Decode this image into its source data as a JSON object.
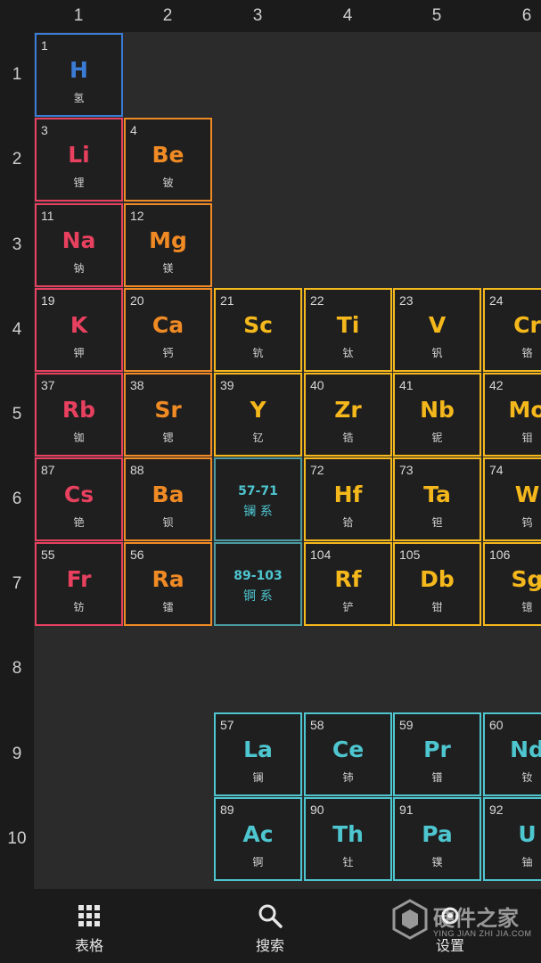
{
  "columns": [
    "1",
    "2",
    "3",
    "4",
    "5",
    "6"
  ],
  "rows": [
    "1",
    "2",
    "3",
    "4",
    "5",
    "6",
    "7",
    "8",
    "9",
    "10"
  ],
  "colors": {
    "hydrogen": "#3a7bd5",
    "alkali": "#e8405f",
    "alkaline": "#f08a24",
    "transition": "#f5b81c",
    "lanthanide_actinide": "#4ec6d0"
  },
  "elements": [
    {
      "n": "1",
      "sym": "H",
      "cn": "氢",
      "col": 1,
      "row": 1,
      "cat": "hydrogen"
    },
    {
      "n": "3",
      "sym": "Li",
      "cn": "锂",
      "col": 1,
      "row": 2,
      "cat": "alkali"
    },
    {
      "n": "4",
      "sym": "Be",
      "cn": "铍",
      "col": 2,
      "row": 2,
      "cat": "alkaline"
    },
    {
      "n": "11",
      "sym": "Na",
      "cn": "钠",
      "col": 1,
      "row": 3,
      "cat": "alkali"
    },
    {
      "n": "12",
      "sym": "Mg",
      "cn": "镁",
      "col": 2,
      "row": 3,
      "cat": "alkaline"
    },
    {
      "n": "19",
      "sym": "K",
      "cn": "钾",
      "col": 1,
      "row": 4,
      "cat": "alkali"
    },
    {
      "n": "20",
      "sym": "Ca",
      "cn": "钙",
      "col": 2,
      "row": 4,
      "cat": "alkaline"
    },
    {
      "n": "21",
      "sym": "Sc",
      "cn": "钪",
      "col": 3,
      "row": 4,
      "cat": "transition"
    },
    {
      "n": "22",
      "sym": "Ti",
      "cn": "钛",
      "col": 4,
      "row": 4,
      "cat": "transition"
    },
    {
      "n": "23",
      "sym": "V",
      "cn": "钒",
      "col": 5,
      "row": 4,
      "cat": "transition"
    },
    {
      "n": "24",
      "sym": "Cr",
      "cn": "铬",
      "col": 6,
      "row": 4,
      "cat": "transition"
    },
    {
      "n": "37",
      "sym": "Rb",
      "cn": "铷",
      "col": 1,
      "row": 5,
      "cat": "alkali"
    },
    {
      "n": "38",
      "sym": "Sr",
      "cn": "锶",
      "col": 2,
      "row": 5,
      "cat": "alkaline"
    },
    {
      "n": "39",
      "sym": "Y",
      "cn": "钇",
      "col": 3,
      "row": 5,
      "cat": "transition"
    },
    {
      "n": "40",
      "sym": "Zr",
      "cn": "锆",
      "col": 4,
      "row": 5,
      "cat": "transition"
    },
    {
      "n": "41",
      "sym": "Nb",
      "cn": "铌",
      "col": 5,
      "row": 5,
      "cat": "transition"
    },
    {
      "n": "42",
      "sym": "Mo",
      "cn": "钼",
      "col": 6,
      "row": 5,
      "cat": "transition"
    },
    {
      "n": "87",
      "sym": "Cs",
      "cn": "铯",
      "col": 1,
      "row": 6,
      "cat": "alkali"
    },
    {
      "n": "88",
      "sym": "Ba",
      "cn": "钡",
      "col": 2,
      "row": 6,
      "cat": "alkaline"
    },
    {
      "n": "72",
      "sym": "Hf",
      "cn": "铪",
      "col": 4,
      "row": 6,
      "cat": "transition"
    },
    {
      "n": "73",
      "sym": "Ta",
      "cn": "钽",
      "col": 5,
      "row": 6,
      "cat": "transition"
    },
    {
      "n": "74",
      "sym": "W",
      "cn": "钨",
      "col": 6,
      "row": 6,
      "cat": "transition"
    },
    {
      "n": "55",
      "sym": "Fr",
      "cn": "钫",
      "col": 1,
      "row": 7,
      "cat": "alkali"
    },
    {
      "n": "56",
      "sym": "Ra",
      "cn": "镭",
      "col": 2,
      "row": 7,
      "cat": "alkaline"
    },
    {
      "n": "104",
      "sym": "Rf",
      "cn": "铲",
      "col": 4,
      "row": 7,
      "cat": "transition"
    },
    {
      "n": "105",
      "sym": "Db",
      "cn": "钳",
      "col": 5,
      "row": 7,
      "cat": "transition"
    },
    {
      "n": "106",
      "sym": "Sg",
      "cn": "镱",
      "col": 6,
      "row": 7,
      "cat": "transition"
    },
    {
      "n": "57",
      "sym": "La",
      "cn": "镧",
      "col": 3,
      "row": 9,
      "cat": "lanthanide_actinide"
    },
    {
      "n": "58",
      "sym": "Ce",
      "cn": "铈",
      "col": 4,
      "row": 9,
      "cat": "lanthanide_actinide"
    },
    {
      "n": "59",
      "sym": "Pr",
      "cn": "镨",
      "col": 5,
      "row": 9,
      "cat": "lanthanide_actinide"
    },
    {
      "n": "60",
      "sym": "Nd",
      "cn": "钕",
      "col": 6,
      "row": 9,
      "cat": "lanthanide_actinide"
    },
    {
      "n": "89",
      "sym": "Ac",
      "cn": "锕",
      "col": 3,
      "row": 10,
      "cat": "lanthanide_actinide"
    },
    {
      "n": "90",
      "sym": "Th",
      "cn": "钍",
      "col": 4,
      "row": 10,
      "cat": "lanthanide_actinide"
    },
    {
      "n": "91",
      "sym": "Pa",
      "cn": "镤",
      "col": 5,
      "row": 10,
      "cat": "lanthanide_actinide"
    },
    {
      "n": "92",
      "sym": "U",
      "cn": "铀",
      "col": 6,
      "row": 10,
      "cat": "lanthanide_actinide"
    }
  ],
  "series_cells": [
    {
      "range": "57-71",
      "label": "镧 系",
      "col": 3,
      "row": 6
    },
    {
      "range": "89-103",
      "label": "锕 系",
      "col": 3,
      "row": 7
    }
  ],
  "nav": {
    "table": {
      "label": "表格",
      "icon": "grid-icon"
    },
    "search": {
      "label": "搜索",
      "icon": "search-icon"
    },
    "settings": {
      "label": "设置",
      "icon": "gear-icon"
    }
  },
  "watermark": {
    "text": "硬件之家",
    "sub": "YING JIAN ZHI JIA.COM"
  }
}
